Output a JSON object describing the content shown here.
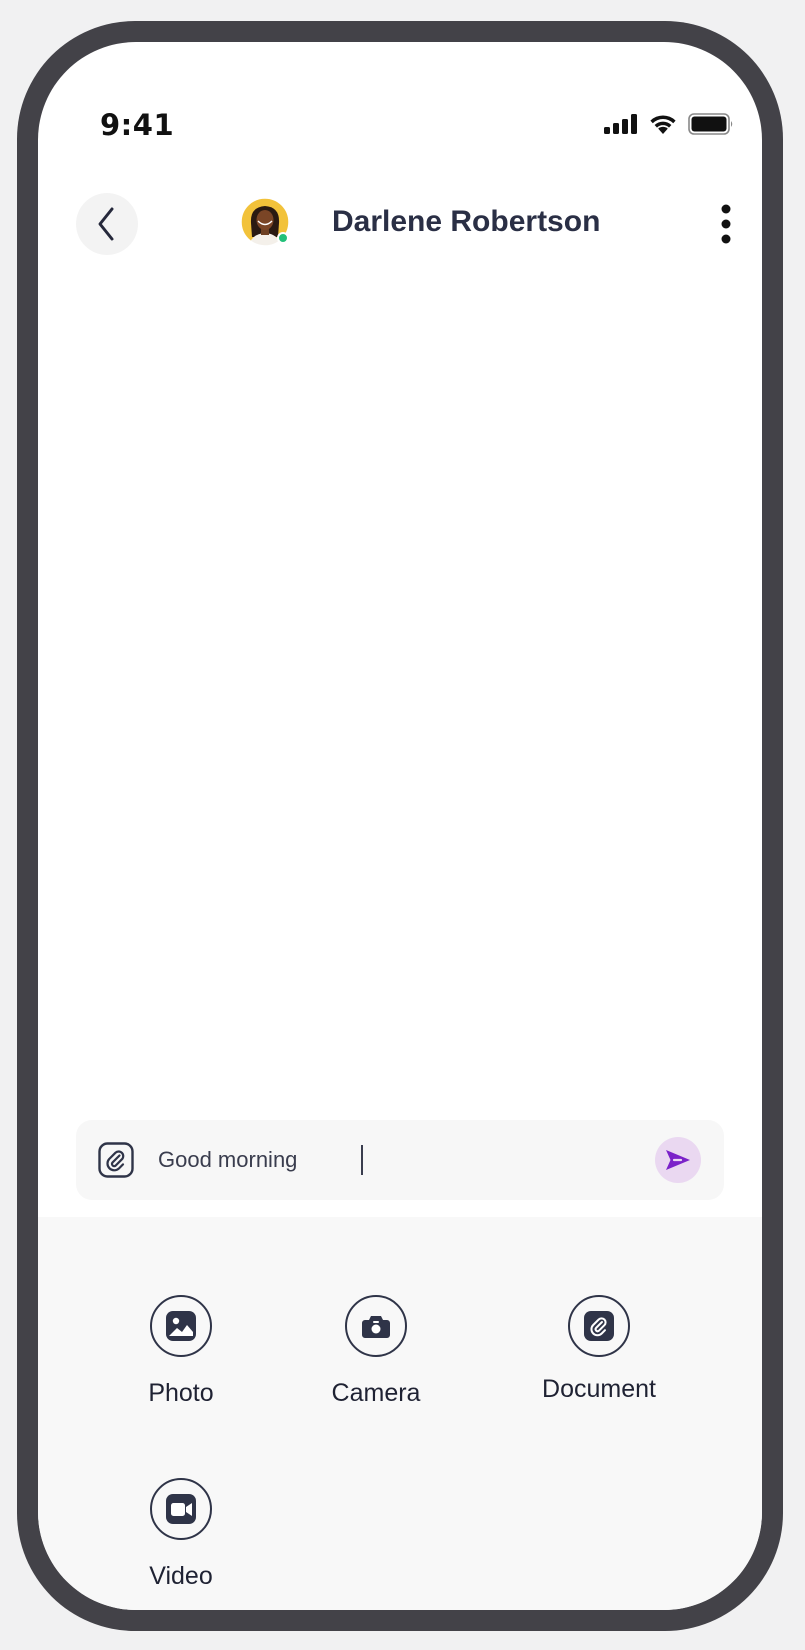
{
  "status_bar": {
    "time": "9:41",
    "icons": [
      "cellular-signal-icon",
      "wifi-icon",
      "battery-icon"
    ]
  },
  "header": {
    "back_icon": "chevron-left-icon",
    "contact_name": "Darlene Robertson",
    "online_status_color": "#22c079",
    "menu_icon": "more-vertical-icon"
  },
  "composer": {
    "attach_icon": "attachment-icon",
    "value": "Good morning",
    "send_icon": "send-icon",
    "accent": "#7b22c9"
  },
  "attachment_options": [
    {
      "label": "Photo",
      "icon": "image-icon"
    },
    {
      "label": "Camera",
      "icon": "camera-icon"
    },
    {
      "label": "Document",
      "icon": "document-link-icon"
    },
    {
      "label": "Video",
      "icon": "video-camera-icon"
    }
  ]
}
